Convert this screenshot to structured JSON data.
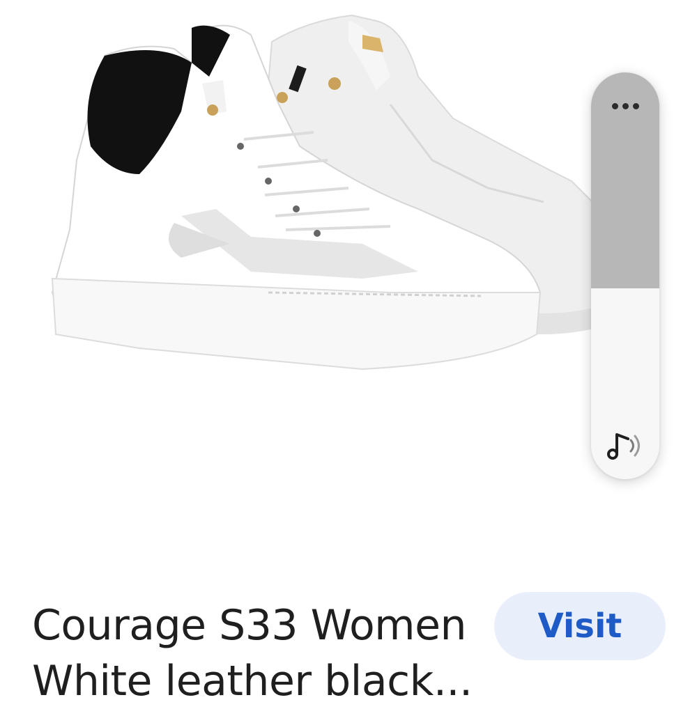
{
  "product": {
    "image_alt": "White leather sneakers with black heel tab",
    "title_line1": "Courage S33 Women",
    "title_line2": "White leather black..."
  },
  "visit_button": {
    "label": "Visit"
  },
  "volume_panel": {
    "more_icon": "more-horizontal-icon",
    "speaker_icon": "music-note-volume-icon",
    "level_fraction": 0.47
  },
  "colors": {
    "visit_bg": "#e8effb",
    "visit_text": "#1f5bc6",
    "panel_track": "#b7b7b7",
    "panel_bg": "#f7f7f7"
  }
}
